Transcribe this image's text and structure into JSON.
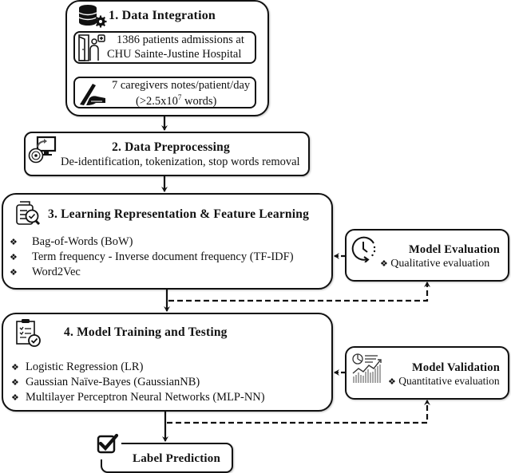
{
  "step1": {
    "title": "1. Data Integration",
    "icon": "database-gear-icon",
    "source": {
      "icon": "patient-admission-icon",
      "line1": "1386 patients admissions at",
      "line2": "CHU Sainte-Justine Hospital"
    },
    "notes": {
      "icon": "writing-hand-icon",
      "line1": "7 caregivers notes/patient/day",
      "line2_prefix": "(>2.5x10",
      "line2_sup": "7",
      "line2_suffix": " words)"
    }
  },
  "step2": {
    "title": "2. Data Preprocessing",
    "icon": "monitor-disc-icon",
    "description": "De-identification, tokenization, stop words removal"
  },
  "step3": {
    "title": "3. Learning Representation & Feature Learning",
    "icon": "document-search-icon",
    "bullet": "❖",
    "items": [
      "Bag-of-Words (BoW)",
      "Term frequency - Inverse document frequency (TF-IDF)",
      "Word2Vec"
    ]
  },
  "step4": {
    "title": "4. Model Training and Testing",
    "icon": "clipboard-check-icon",
    "bullet": "❖",
    "items": [
      "Logistic Regression (LR)",
      "Gaussian Naïve-Bayes (GaussianNB)",
      "Multilayer Perceptron Neural Networks (MLP-NN)"
    ]
  },
  "evaluation": {
    "title": "Model Evaluation",
    "icon": "clock-cycle-icon",
    "bullet": "❖",
    "item": "Qualitative evaluation"
  },
  "validation": {
    "title": "Model Validation",
    "icon": "chart-report-icon",
    "bullet": "❖",
    "item": "Quantitative evaluation"
  },
  "output": {
    "title": "Label Prediction",
    "icon": "checkbox-icon"
  }
}
